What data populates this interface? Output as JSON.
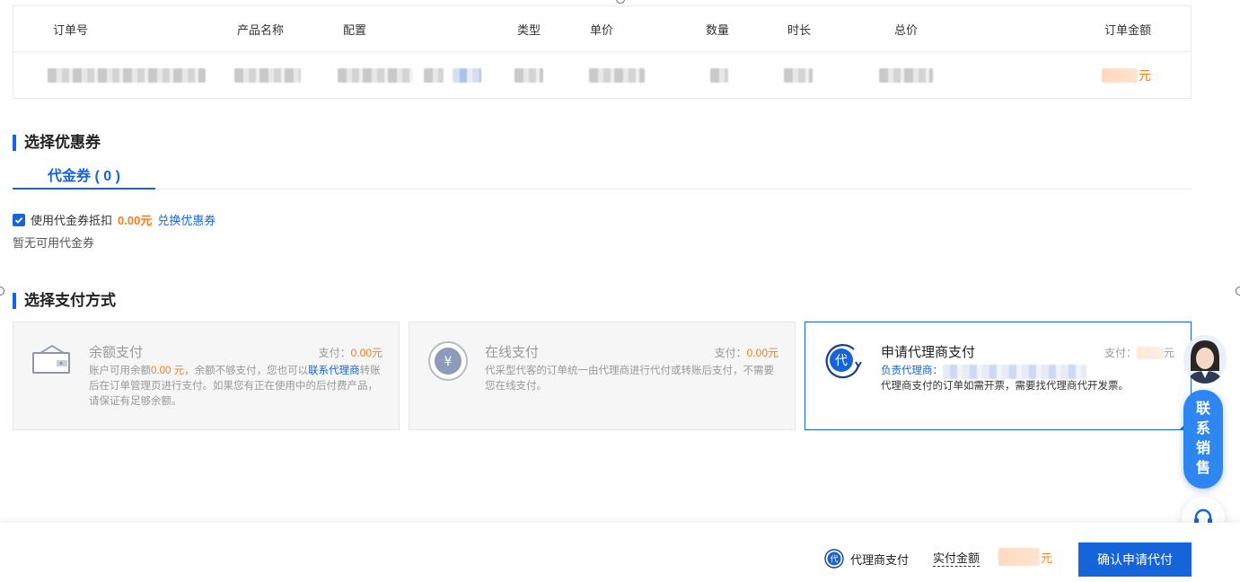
{
  "order_table": {
    "headers": [
      "订单号",
      "产品名称",
      "配置",
      "类型",
      "单价",
      "数量",
      "时长",
      "总价",
      "订单金额"
    ],
    "amount_unit": "元"
  },
  "coupon_section": {
    "title": "选择优惠券",
    "tab_label": "代金券 ( 0 )",
    "use_coupon_label": "使用代金券抵扣",
    "use_coupon_checked": true,
    "discount_amount": "0.00元",
    "redeem_link": "兑换优惠券",
    "empty_text": "暂无可用代金券"
  },
  "payment_section": {
    "title": "选择支付方式",
    "methods": [
      {
        "title": "余额支付",
        "amount_label": "支付：",
        "amount_value": "0.00元",
        "desc_prefix": "账户可用余额",
        "desc_balance": "0.00 元",
        "desc_mid": "，余额不够支付，您也可以",
        "desc_link": "联系代理商",
        "desc_suffix": "转账后在订单管理页进行支付。如果您有正在使用中的后付费产品，请保证有足够余额。",
        "icon": "wallet-icon",
        "selected": false
      },
      {
        "title": "在线支付",
        "amount_label": "支付：",
        "amount_value": "0.00元",
        "desc": "代采型代客的订单统一由代理商进行代付或转账后支付，不需要您在线支付。",
        "icon": "yen-coin-icon",
        "selected": false
      },
      {
        "title": "申请代理商支付",
        "amount_label": "支付：",
        "amount_unit": "元",
        "agent_label": "负责代理商：",
        "desc": "代理商支付的订单如需开票，需要找代理商代开发票。",
        "icon": "agent-pay-icon",
        "icon_char": "代",
        "selected": true
      }
    ]
  },
  "floating": {
    "sales_label": [
      "联",
      "系",
      "销",
      "售"
    ]
  },
  "bottom_bar": {
    "method_icon_char": "代",
    "method_label": "代理商支付",
    "actual_amount_label": "实付金额",
    "amount_unit": "元",
    "confirm_label": "确认申请代付"
  },
  "colors": {
    "primary": "#1664d9",
    "accent": "#ff7a1a"
  }
}
